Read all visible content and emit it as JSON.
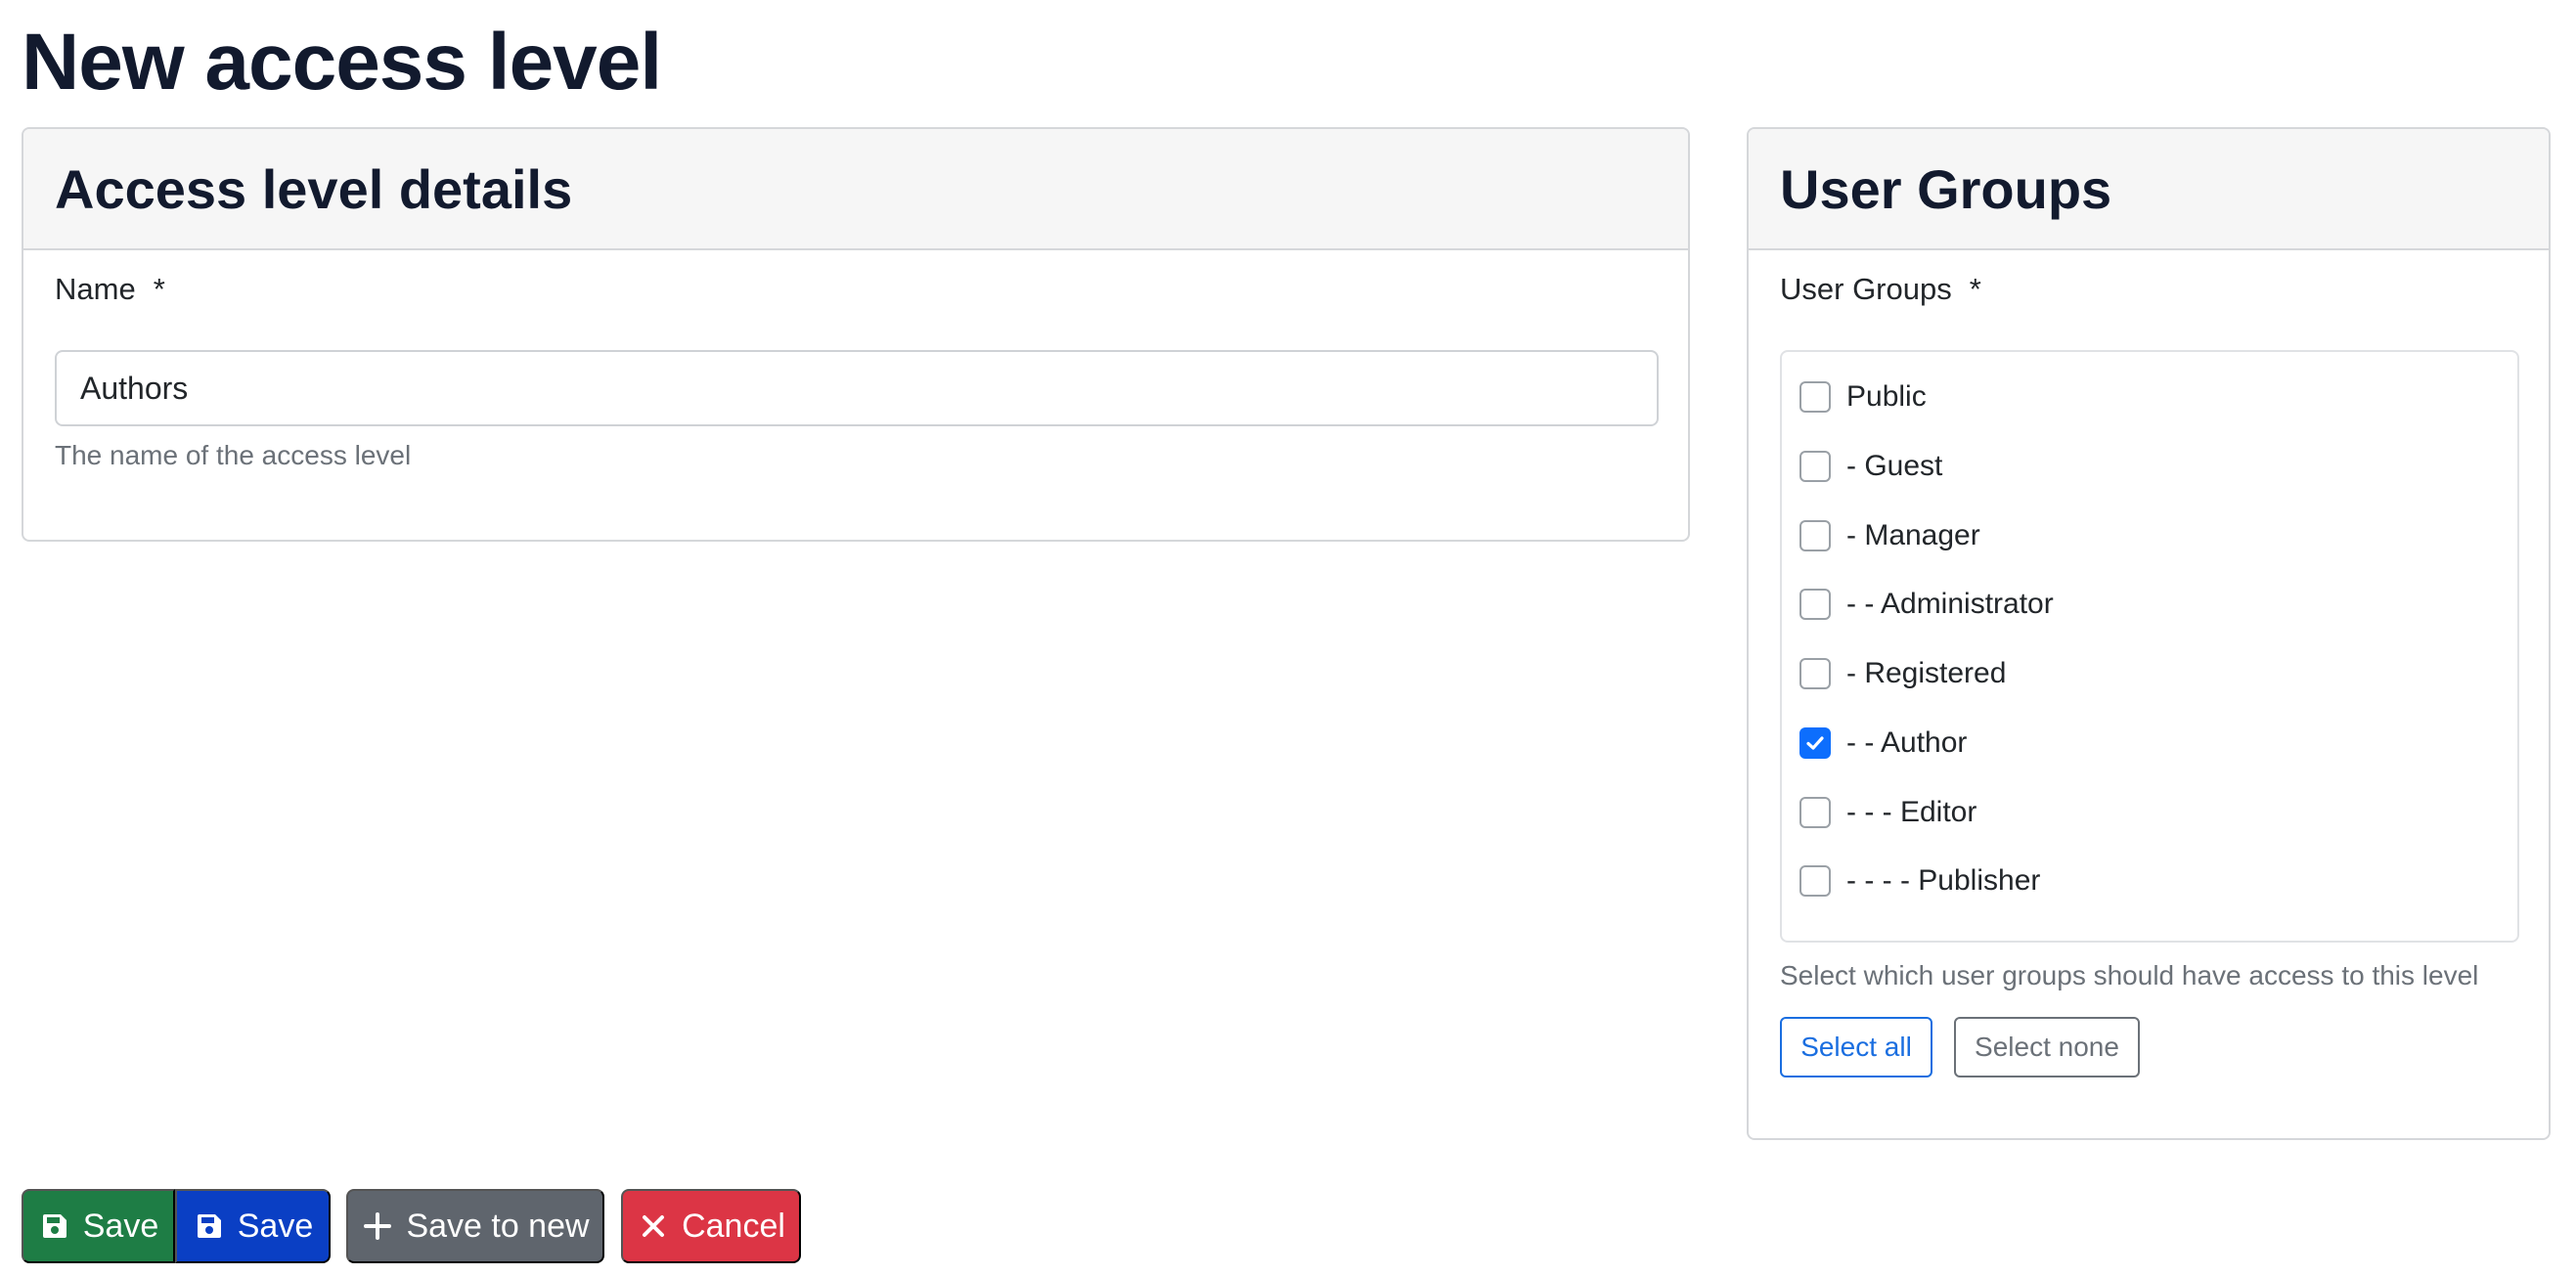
{
  "page": {
    "title": "New access level"
  },
  "details": {
    "header": "Access level details",
    "name_label": "Name",
    "required_mark": "*",
    "name_value": "Authors",
    "name_help": "The name of the access level"
  },
  "groups": {
    "header": "User Groups",
    "label": "User Groups",
    "required_mark": "*",
    "items": [
      {
        "label": "Public",
        "checked": false
      },
      {
        "label": "- Guest",
        "checked": false
      },
      {
        "label": "- Manager",
        "checked": false
      },
      {
        "label": "- - Administrator",
        "checked": false
      },
      {
        "label": "- Registered",
        "checked": false
      },
      {
        "label": "- - Author",
        "checked": true
      },
      {
        "label": "- - - Editor",
        "checked": false
      },
      {
        "label": "- - - - Publisher",
        "checked": false
      }
    ],
    "help": "Select which user groups should have access to this level",
    "select_all_label": "Select all",
    "select_none_label": "Select none"
  },
  "toolbar": {
    "save_label": "Save",
    "save_close_label": "Save",
    "save_new_label": "Save to new",
    "cancel_label": "Cancel"
  },
  "icons": {
    "save": "floppy-disk-icon",
    "add": "plus-icon",
    "cancel": "x-icon",
    "check": "checkmark-icon"
  },
  "colors": {
    "save_green": "#1e7d45",
    "save_blue": "#0a3fc4",
    "save_new_gray": "#5f656d",
    "cancel_red": "#dc3545",
    "checkbox_checked": "#0d6efd"
  }
}
